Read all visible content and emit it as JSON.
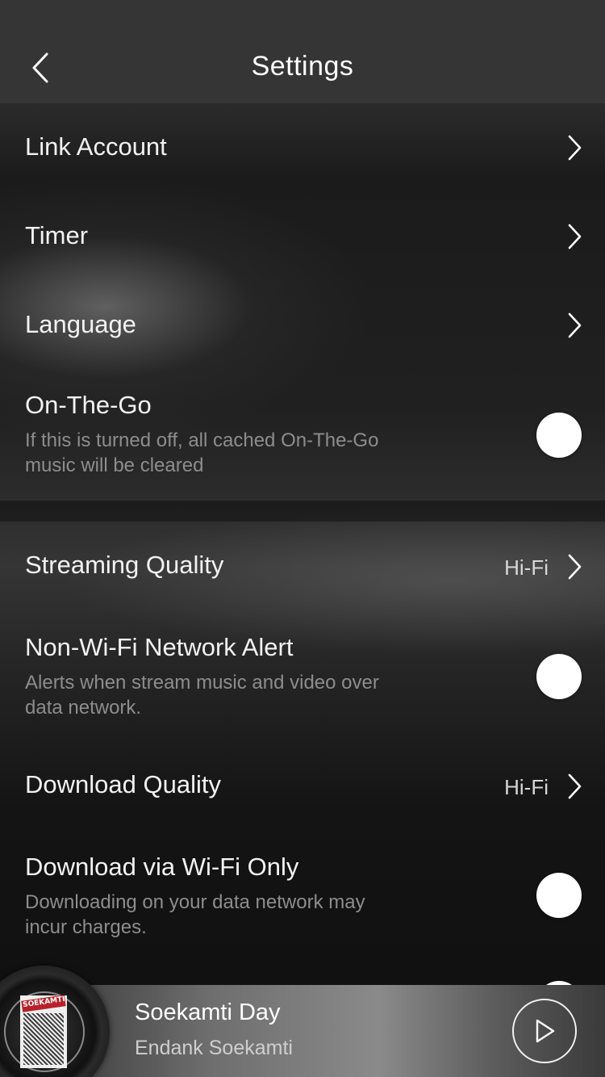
{
  "header": {
    "title": "Settings",
    "back_icon": "chevron-left-icon"
  },
  "section1": {
    "link_account": "Link Account",
    "timer": "Timer",
    "language": "Language",
    "on_the_go": {
      "label": "On-The-Go",
      "description": "If this is turned off, all cached On-The-Go music will be cleared"
    }
  },
  "section2": {
    "streaming_quality": {
      "label": "Streaming Quality",
      "value": "Hi-Fi"
    },
    "non_wifi_alert": {
      "label": "Non-Wi-Fi Network Alert",
      "description": "Alerts when stream music and video over data network."
    },
    "download_quality": {
      "label": "Download Quality",
      "value": "Hi-Fi"
    },
    "download_wifi_only": {
      "label": "Download via Wi-Fi Only",
      "description": "Downloading on your data network may incur charges."
    }
  },
  "player": {
    "song_title": "Soekamti Day",
    "artist": "Endank Soekamti",
    "album_logo_text": "SOEKAMTI DAY",
    "play_icon": "play-icon"
  },
  "colors": {
    "header_bg": "#353535",
    "text_primary": "#f2f2f2",
    "text_secondary": "#8d8d8d",
    "toggle_knob": "#ffffff"
  }
}
